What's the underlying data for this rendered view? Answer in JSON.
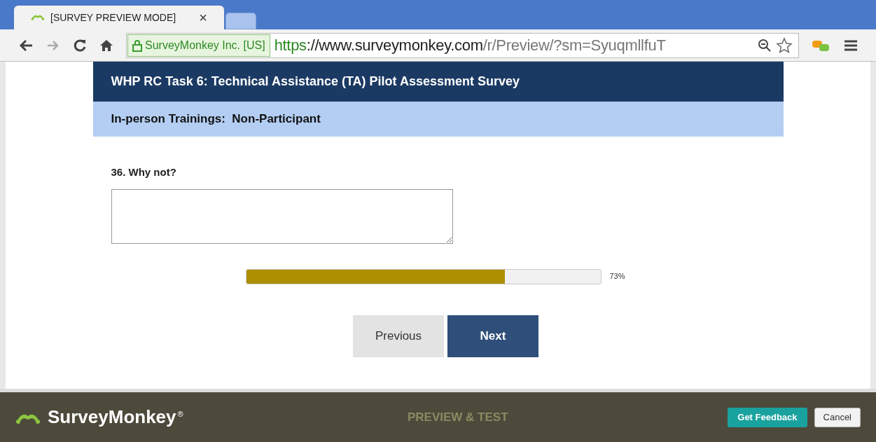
{
  "browser": {
    "tabs": [
      {
        "title": "[SURVEY PREVIEW MODE]",
        "close": "×",
        "selected": true
      },
      {
        "selected": false
      }
    ],
    "security_badge": "SurveyMonkey Inc. [US]",
    "url_parts": [
      "https",
      "://www.surveymonkey.com",
      "/r/Preview/?sm=SyuqmllfuT"
    ]
  },
  "survey": {
    "title": "WHP RC Task 6: Technical Assistance (TA) Pilot Assessment Survey",
    "section": "In-person Trainings:  Non-Participant",
    "question": "36. Why not?",
    "progress": {
      "level": 0.73,
      "reading": "73%"
    },
    "buttons": [
      {
        "label": "Previous",
        "kind": "secondary"
      },
      {
        "label": "Next",
        "kind": "primary"
      }
    ]
  },
  "footer": {
    "brand": "SurveyMonkey",
    "brand_mark": "®",
    "mode": "PREVIEW & TEST",
    "buttons": [
      {
        "label": "Get Feedback",
        "kind": "primary"
      },
      {
        "label": "Cancel",
        "kind": "secondary"
      }
    ]
  }
}
